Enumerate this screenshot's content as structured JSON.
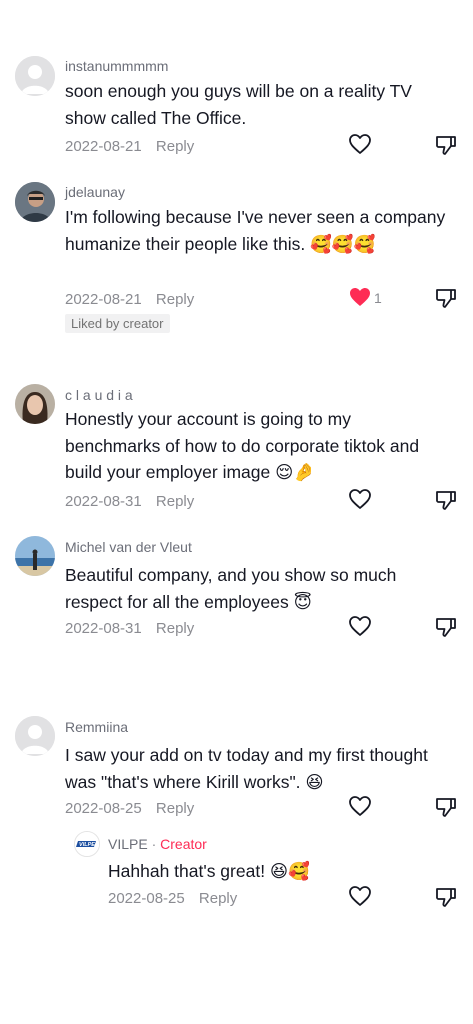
{
  "comments": [
    {
      "username": "instanummmmm",
      "text": "soon enough you guys will be on a reality TV show called The Office.",
      "date": "2022-08-21",
      "reply": "Reply"
    },
    {
      "username": "jdelaunay",
      "text": "I'm following because I've never seen a company humanize their people like this. 🥰🥰🥰",
      "date": "2022-08-21",
      "reply": "Reply",
      "like_count": "1",
      "liked_by_creator": "Liked by creator"
    },
    {
      "username": "c l a u d i a",
      "text": "Honestly your account is going to my benchmarks of how to do corporate tiktok and build your employer image 😌🤌",
      "date": "2022-08-31",
      "reply": "Reply"
    },
    {
      "username": "Michel van der Vleut",
      "text": "Beautiful company, and you show so much respect for all the employees 😇",
      "date": "2022-08-31",
      "reply": "Reply"
    },
    {
      "username": "Remmiina",
      "text": "I saw your add on tv today and my first thought was \"that's where Kirill works\". 😆",
      "date": "2022-08-25",
      "reply": "Reply"
    }
  ],
  "creator_reply": {
    "username": "VILPE",
    "separator": "·",
    "tag": "Creator",
    "logo_text": "VILPE",
    "text": "Hahhah that's great! 😆🥰",
    "date": "2022-08-25",
    "reply": "Reply"
  },
  "colors": {
    "liked_heart": "#fe2c55",
    "creator_tag": "#fe2c55",
    "meta": "#8a8b91"
  },
  "icons": {
    "like": "heart-outline-icon",
    "liked": "heart-filled-icon",
    "dislike": "thumbs-down-icon"
  }
}
